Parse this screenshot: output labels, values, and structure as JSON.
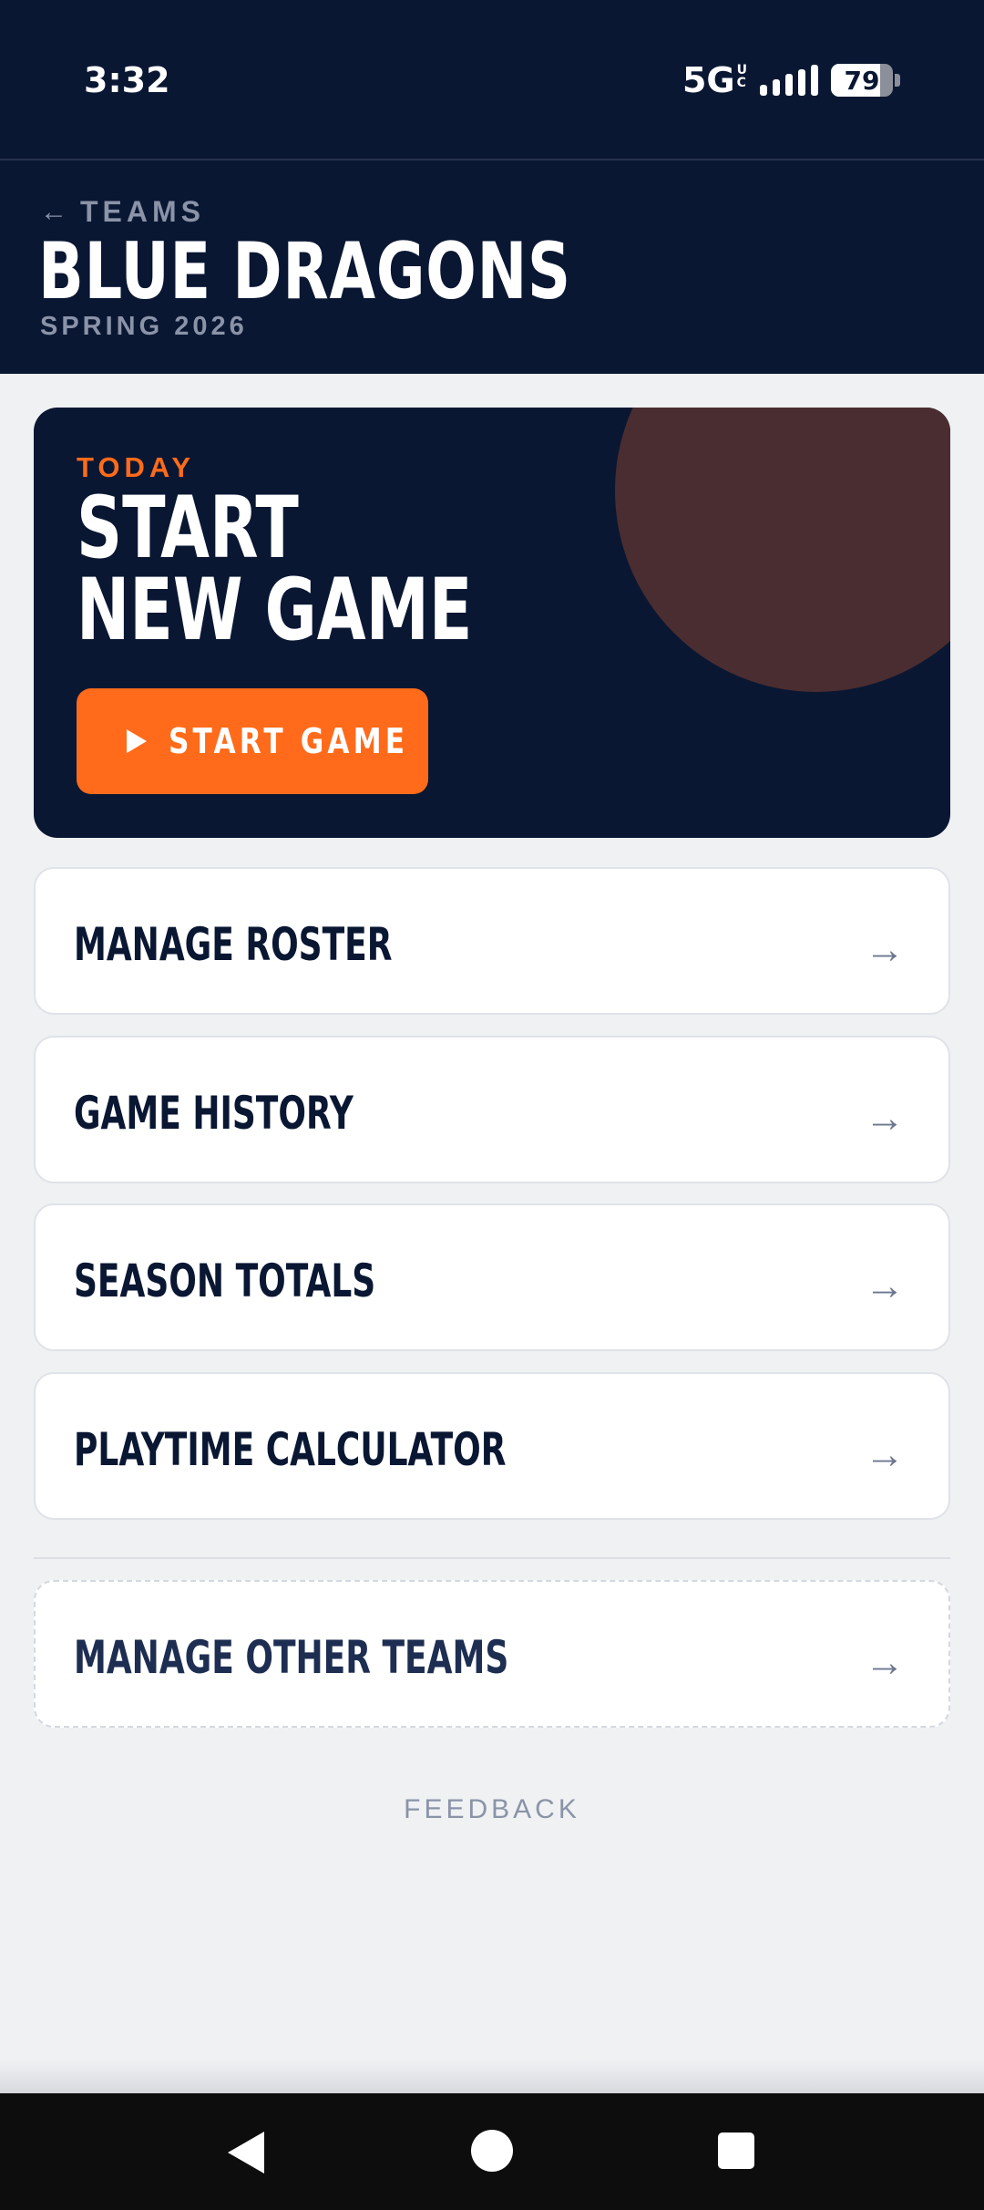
{
  "status_bar": {
    "time": "3:32",
    "network": "5G",
    "network_sup_top": "U",
    "network_sup_bottom": "C",
    "battery_level": 79,
    "battery_text": "79",
    "icons": [
      "signal-icon",
      "battery-icon"
    ]
  },
  "header": {
    "back_arrow": "←",
    "back_label": "TEAMS",
    "team_name": "BLUE DRAGONS",
    "season": "SPRING 2026"
  },
  "hero": {
    "eyebrow": "TODAY",
    "title_line1": "START",
    "title_line2": "NEW GAME",
    "button_label": "START GAME",
    "button_icon": "play-icon"
  },
  "menu": {
    "items": [
      {
        "label": "MANAGE ROSTER",
        "arrow": "→"
      },
      {
        "label": "GAME HISTORY",
        "arrow": "→"
      },
      {
        "label": "SEASON TOTALS",
        "arrow": "→"
      },
      {
        "label": "PLAYTIME CALCULATOR",
        "arrow": "→"
      }
    ],
    "other": {
      "label": "MANAGE OTHER TEAMS",
      "arrow": "→"
    }
  },
  "footer": {
    "feedback": "FEEDBACK"
  },
  "colors": {
    "navy": "#0a1733",
    "accent_orange": "#ff6b1a",
    "muted": "#8a93a8",
    "background": "#f0f1f3"
  },
  "nav_bar": {
    "icons": [
      "back-icon",
      "home-icon",
      "recents-icon"
    ]
  }
}
